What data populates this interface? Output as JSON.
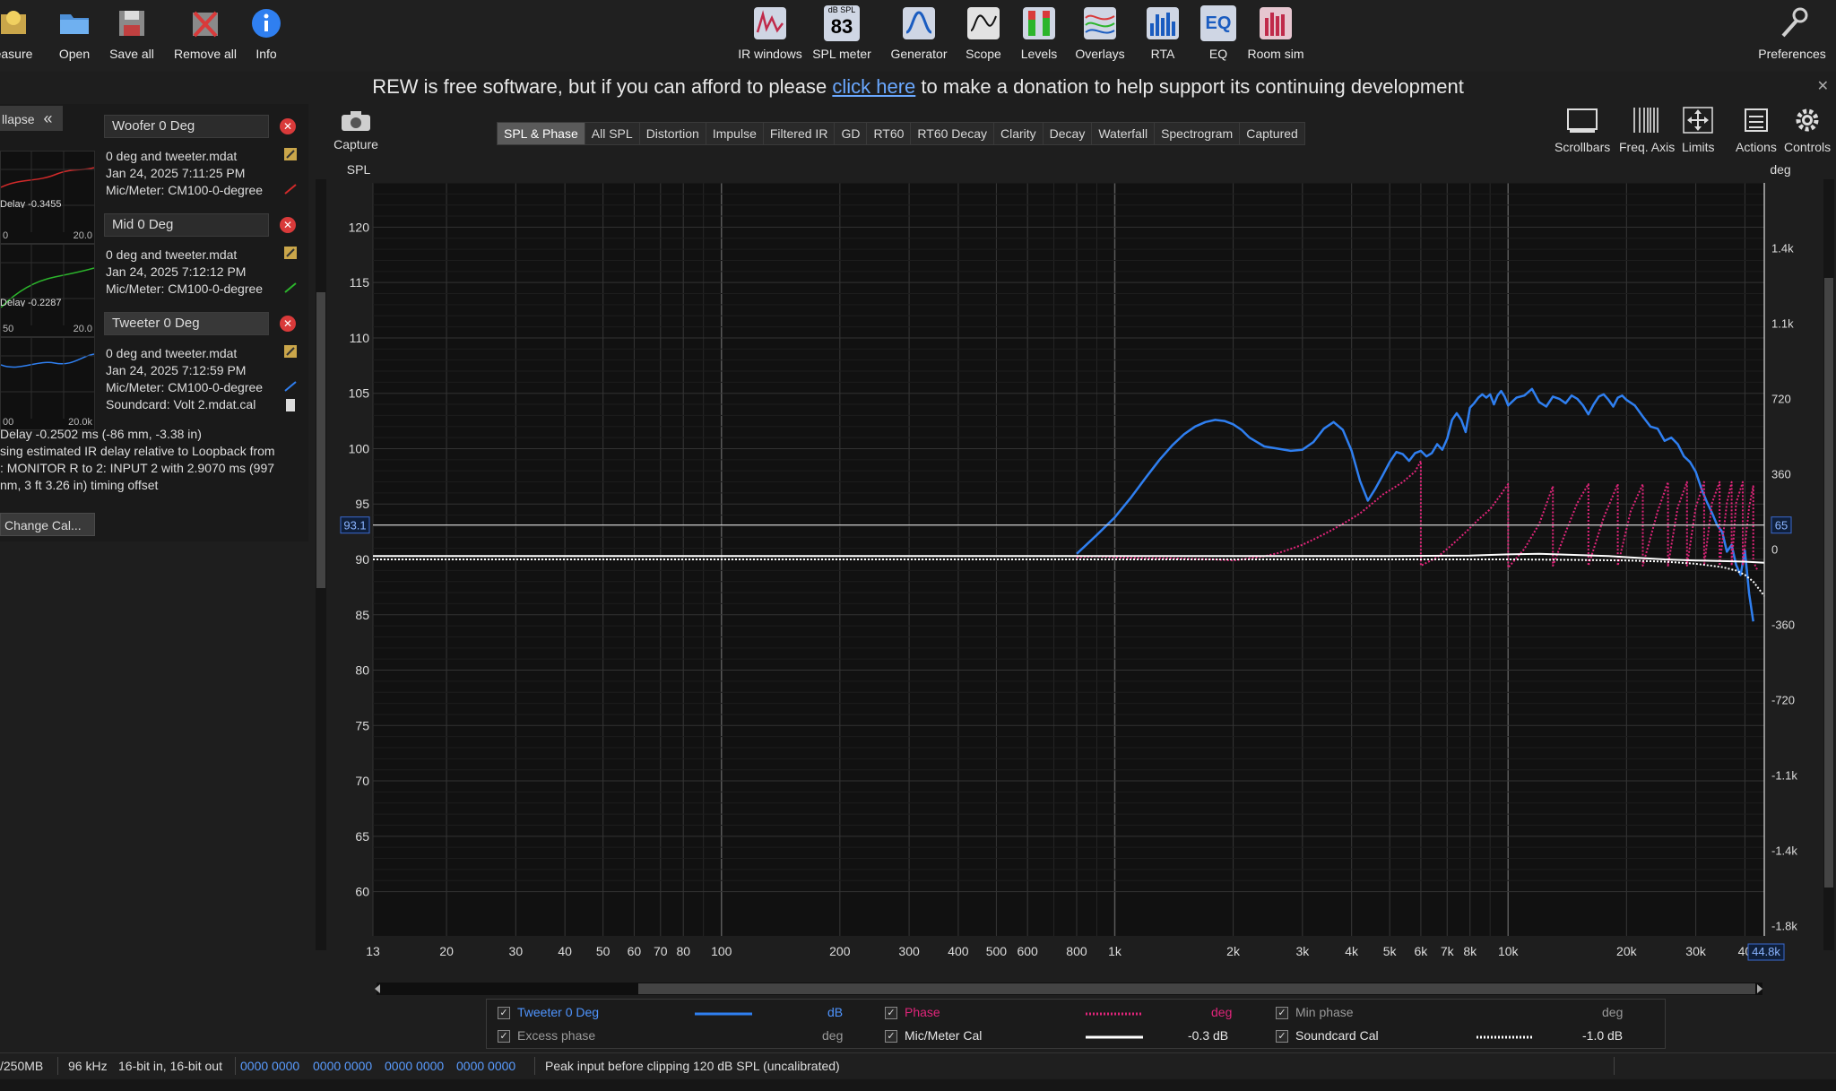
{
  "toolbar": {
    "left": [
      {
        "label": "easure",
        "icon": "measure-icon"
      },
      {
        "label": "Open",
        "icon": "folder-icon"
      },
      {
        "label": "Save all",
        "icon": "save-icon"
      },
      {
        "label": "Remove all",
        "icon": "remove-all-icon"
      },
      {
        "label": "Info",
        "icon": "info-icon"
      }
    ],
    "center": [
      {
        "label": "IR windows",
        "icon": "ir-windows-icon"
      },
      {
        "label": "SPL meter",
        "icon": "spl-meter-icon",
        "badge_top": "dB SPL",
        "badge_value": "83"
      },
      {
        "label": "Generator",
        "icon": "generator-icon"
      },
      {
        "label": "Scope",
        "icon": "scope-icon"
      },
      {
        "label": "Levels",
        "icon": "levels-icon"
      },
      {
        "label": "Overlays",
        "icon": "overlays-icon"
      },
      {
        "label": "RTA",
        "icon": "rta-icon"
      },
      {
        "label": "EQ",
        "icon": "eq-icon"
      },
      {
        "label": "Room sim",
        "icon": "room-sim-icon"
      }
    ],
    "preferences": "Preferences"
  },
  "banner": {
    "before": "REW is free software, but if you can afford to please ",
    "link": "click here",
    "after": " to make a donation to help support its continuing development",
    "close": "✕"
  },
  "left_panel": {
    "collapse": "llapse",
    "collapse_glyph": "«",
    "measurements": [
      {
        "name": "Woofer 0 Deg",
        "lines": [
          "0 deg and tweeter.mdat",
          "Jan 24, 2025 7:11:25 PM",
          "Mic/Meter: CM100-0-degree"
        ],
        "thumb_lo": "0",
        "thumb_hi": "20.0",
        "color": "#d12a2a",
        "peek": "Delay -0.3455"
      },
      {
        "name": "Mid 0 Deg",
        "lines": [
          "0 deg and tweeter.mdat",
          "Jan 24, 2025 7:12:12 PM",
          "Mic/Meter: CM100-0-degree"
        ],
        "thumb_lo": "50",
        "thumb_hi": "20.0",
        "color": "#2cb52c",
        "peek": "Delay -0.2287"
      },
      {
        "name": "Tweeter 0 Deg",
        "lines": [
          "0 deg and tweeter.mdat",
          "Jan 24, 2025 7:12:59 PM",
          "Mic/Meter: CM100-0-degree",
          "Soundcard: Volt 2.mdat.cal"
        ],
        "thumb_lo": "00",
        "thumb_hi": "20.0k",
        "color": "#2f7ff0",
        "peek": ""
      }
    ],
    "info_lines": [
      "Delay -0.2502 ms (-86 mm, -3.38 in)",
      "sing estimated IR delay relative to Loopback from",
      ": MONITOR R to 2: INPUT 2 with 2.9070 ms (997",
      "nm, 3 ft 3.26 in) timing offset"
    ],
    "change_cal": "Change Cal..."
  },
  "capture": "Capture",
  "tabs": [
    "SPL & Phase",
    "All SPL",
    "Distortion",
    "Impulse",
    "Filtered IR",
    "GD",
    "RT60",
    "RT60 Decay",
    "Clarity",
    "Decay",
    "Waterfall",
    "Spectrogram",
    "Captured"
  ],
  "active_tab": "SPL & Phase",
  "right_tools": [
    "Scrollbars",
    "Freq. Axis",
    "Limits",
    "Actions",
    "Controls"
  ],
  "chart_data": {
    "type": "line",
    "xscale": "log",
    "xlim": [
      13,
      44800
    ],
    "ylabel": "SPL",
    "ylim": [
      56,
      124
    ],
    "y2label": "deg",
    "y2lim": [
      -1850,
      1750
    ],
    "x_ticks": [
      "13",
      "20",
      "30",
      "40",
      "50",
      "60",
      "70",
      "80",
      "100",
      "200",
      "300",
      "400",
      "500",
      "600",
      "800",
      "1k",
      "2k",
      "3k",
      "4k",
      "5k",
      "6k",
      "7k",
      "8k",
      "10k",
      "20k",
      "30k",
      "40"
    ],
    "x_tick_values": [
      13,
      20,
      30,
      40,
      50,
      60,
      70,
      80,
      100,
      200,
      300,
      400,
      500,
      600,
      800,
      1000,
      2000,
      3000,
      4000,
      5000,
      6000,
      7000,
      8000,
      10000,
      20000,
      30000,
      40000
    ],
    "x_cursor_label": "44.8k",
    "x_unit": "Hz",
    "y_ticks": [
      60,
      65,
      70,
      75,
      80,
      85,
      90,
      95,
      100,
      105,
      110,
      115,
      120
    ],
    "y2_ticks": [
      {
        "v": 1440,
        "label": "1.4k"
      },
      {
        "v": 1080,
        "label": "1.1k"
      },
      {
        "v": 720,
        "label": "720"
      },
      {
        "v": 360,
        "label": "360"
      },
      {
        "v": 0,
        "label": "0"
      },
      {
        "v": -360,
        "label": "-360"
      },
      {
        "v": -720,
        "label": "-720"
      },
      {
        "v": -1080,
        "label": "-1.1k"
      },
      {
        "v": -1440,
        "label": "-1.4k"
      },
      {
        "v": -1800,
        "label": "-1.8k"
      }
    ],
    "cursor": {
      "y_spl": 93.1,
      "y_spl_label": "93.1",
      "y2_label": "65",
      "x_hz": 44800
    },
    "series": [
      {
        "name": "Tweeter 0 Deg",
        "unit": "dB",
        "color": "#2f7ff0",
        "x": [
          800,
          900,
          1000,
          1100,
          1200,
          1300,
          1400,
          1500,
          1600,
          1700,
          1800,
          1900,
          2000,
          2100,
          2200,
          2400,
          2600,
          2800,
          3000,
          3200,
          3400,
          3600,
          3800,
          4000,
          4200,
          4400,
          4600,
          4800,
          5000,
          5200,
          5400,
          5600,
          5800,
          6000,
          6200,
          6400,
          6600,
          6800,
          7000,
          7200,
          7400,
          7600,
          7800,
          8000,
          8200,
          8400,
          8600,
          8800,
          9000,
          9200,
          9400,
          9600,
          9800,
          10000,
          10500,
          11000,
          11500,
          12000,
          12500,
          13000,
          13500,
          14000,
          14500,
          15000,
          15500,
          16000,
          16500,
          17000,
          17500,
          18000,
          18500,
          19000,
          19500,
          20000,
          21000,
          22000,
          23000,
          24000,
          25000,
          26000,
          27000,
          28000,
          29000,
          30000,
          31000,
          32000,
          33000,
          34000,
          35000,
          36000,
          37000,
          38000,
          39000,
          40000,
          41000,
          42000
        ],
        "y": [
          90.5,
          92.2,
          93.8,
          95.6,
          97.4,
          99.0,
          100.3,
          101.3,
          102.0,
          102.4,
          102.6,
          102.5,
          102.2,
          101.7,
          101.0,
          100.2,
          100.0,
          99.8,
          99.9,
          100.6,
          101.8,
          102.4,
          101.7,
          99.8,
          97.1,
          95.3,
          96.4,
          97.6,
          98.8,
          99.7,
          99.5,
          98.9,
          99.6,
          99.8,
          99.3,
          99.6,
          100.4,
          99.9,
          100.9,
          102.6,
          103.2,
          102.6,
          101.5,
          103.7,
          104.1,
          104.6,
          104.9,
          104.6,
          104.9,
          104.0,
          104.8,
          105.2,
          104.7,
          103.9,
          104.6,
          104.8,
          105.4,
          104.2,
          103.8,
          104.7,
          104.5,
          104.1,
          104.8,
          104.5,
          103.9,
          103.1,
          104.0,
          104.7,
          104.9,
          104.4,
          103.8,
          104.6,
          104.8,
          104.4,
          103.9,
          102.9,
          102.0,
          101.8,
          100.7,
          101.0,
          100.4,
          99.3,
          98.8,
          97.9,
          96.4,
          95.2,
          94.2,
          93.1,
          92.5,
          90.7,
          91.3,
          89.5,
          88.6,
          90.8,
          86.9,
          84.4
        ]
      },
      {
        "name": "Phase",
        "unit": "deg",
        "color": "#e0257a",
        "style": "dotted",
        "x": [
          800,
          900,
          1000,
          1200,
          1400,
          1600,
          1800,
          2000,
          2200,
          2400,
          2600,
          2800,
          3000,
          3200,
          3400,
          3600,
          3800,
          4000,
          4200,
          4400,
          4600,
          4800,
          5000,
          5200,
          5400,
          5600,
          5800,
          6000,
          6000,
          6600,
          7200,
          7800,
          8400,
          9000,
          9500,
          10000,
          10000,
          11000,
          12000,
          13000,
          13000,
          14000,
          15000,
          16000,
          16000,
          17500,
          19000,
          19000,
          20500,
          22000,
          22000,
          24000,
          25500,
          25500,
          27000,
          28500,
          28500,
          30000,
          31500,
          31500,
          33000,
          34500,
          34500,
          36000,
          37000,
          37000,
          38000,
          39500,
          39500,
          41000,
          42000,
          42000,
          43000
        ],
        "y": [
          -40,
          -35,
          -40,
          -45,
          -45,
          -48,
          -50,
          -55,
          -45,
          -35,
          -20,
          0,
          20,
          45,
          70,
          95,
          120,
          145,
          170,
          200,
          230,
          260,
          280,
          300,
          320,
          345,
          370,
          420,
          -80,
          -40,
          20,
          80,
          140,
          190,
          250,
          310,
          -90,
          0,
          120,
          300,
          -80,
          80,
          220,
          310,
          -80,
          150,
          310,
          -80,
          180,
          310,
          -80,
          180,
          320,
          -80,
          200,
          320,
          -80,
          200,
          320,
          -80,
          220,
          320,
          -80,
          220,
          320,
          -80,
          220,
          320,
          -80,
          200,
          300,
          -60,
          -100
        ]
      },
      {
        "name": "Mic/Meter Cal",
        "unit": "",
        "value": "-0.3 dB",
        "color": "#ffffff",
        "x": [
          13,
          100,
          1000,
          5000,
          8000,
          10000,
          12000,
          15000,
          18000,
          20000,
          25000,
          30000,
          35000,
          40000,
          44800
        ],
        "y": [
          90.3,
          90.3,
          90.3,
          90.3,
          90.35,
          90.45,
          90.5,
          90.4,
          90.3,
          90.2,
          90.0,
          89.9,
          89.85,
          89.8,
          89.7
        ]
      },
      {
        "name": "Soundcard Cal",
        "unit": "",
        "value": "-1.0 dB",
        "color": "#ffffff",
        "style": "dotted",
        "x": [
          13,
          100,
          1000,
          5000,
          10000,
          15000,
          20000,
          25000,
          30000,
          35000,
          38000,
          40000,
          42000,
          44800
        ],
        "y": [
          90.0,
          90.0,
          90.0,
          90.0,
          90.0,
          89.95,
          89.9,
          89.8,
          89.6,
          89.3,
          89.0,
          88.6,
          88.0,
          86.7
        ]
      }
    ]
  },
  "legend": {
    "items": [
      {
        "label": "Tweeter 0 Deg",
        "unit": "dB",
        "checked": true,
        "color": "#2f7ff0"
      },
      {
        "label": "Phase",
        "unit": "deg",
        "checked": true,
        "color": "#e0257a"
      },
      {
        "label": "Min phase",
        "unit": "deg",
        "checked": true,
        "color": "#9a9a9a"
      },
      {
        "label": "Excess phase",
        "unit": "deg",
        "checked": true,
        "color": "#9a9a9a"
      },
      {
        "label": "Mic/Meter Cal",
        "value": "-0.3 dB",
        "checked": true,
        "color": "#ffffff"
      },
      {
        "label": "Soundcard Cal",
        "value": "-1.0 dB",
        "checked": true,
        "color": "#ffffff"
      }
    ],
    "check_glyph": "✓"
  },
  "status": {
    "memory": "/250MB",
    "rate": "96 kHz",
    "bits": "16-bit in, 16-bit out",
    "levels": [
      "0000 0000",
      "0000 0000",
      "0000 0000",
      "0000 0000"
    ],
    "peak": "Peak input before clipping 120 dB SPL (uncalibrated)"
  },
  "colors": {
    "accent": "#2f7ff0",
    "phase": "#e0257a",
    "link": "#6aa8ff",
    "close": "#d93a3a"
  }
}
